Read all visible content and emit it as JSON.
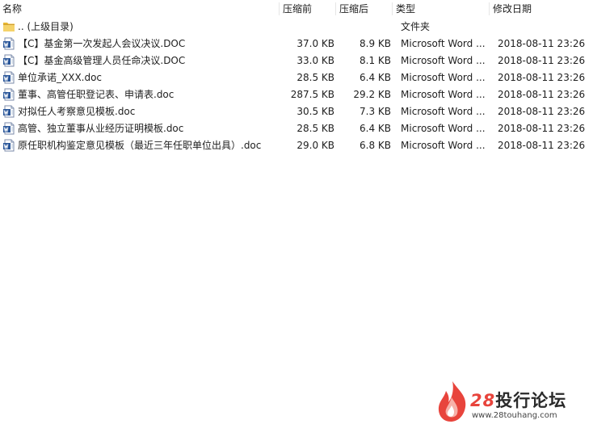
{
  "columns": {
    "name": "名称",
    "size": "压缩前",
    "compressed": "压缩后",
    "type": "类型",
    "modified": "修改日期"
  },
  "parent_row": {
    "name": ".. (上级目录)",
    "type": "文件夹",
    "icon": "folder-icon"
  },
  "files": [
    {
      "name": "【C】基金第一次发起人会议决议.DOC",
      "size": "37.0 KB",
      "compressed": "8.9 KB",
      "type": "Microsoft Word ...",
      "modified": "2018-08-11 23:26",
      "icon": "word-doc-icon"
    },
    {
      "name": "【C】基金高级管理人员任命决议.DOC",
      "size": "33.0 KB",
      "compressed": "8.1 KB",
      "type": "Microsoft Word ...",
      "modified": "2018-08-11 23:26",
      "icon": "word-doc-icon"
    },
    {
      "name": "单位承诺_XXX.doc",
      "size": "28.5 KB",
      "compressed": "6.4 KB",
      "type": "Microsoft Word ...",
      "modified": "2018-08-11 23:26",
      "icon": "word-doc-icon"
    },
    {
      "name": "董事、高管任职登记表、申请表.doc",
      "size": "287.5 KB",
      "compressed": "29.2 KB",
      "type": "Microsoft Word ...",
      "modified": "2018-08-11 23:26",
      "icon": "word-doc-icon"
    },
    {
      "name": "对拟任人考察意见模板.doc",
      "size": "30.5 KB",
      "compressed": "7.3 KB",
      "type": "Microsoft Word ...",
      "modified": "2018-08-11 23:26",
      "icon": "word-doc-icon"
    },
    {
      "name": "高管、独立董事从业经历证明模板.doc",
      "size": "28.5 KB",
      "compressed": "6.4 KB",
      "type": "Microsoft Word ...",
      "modified": "2018-08-11 23:26",
      "icon": "word-doc-icon"
    },
    {
      "name": "原任职机构鉴定意见模板（最近三年任职单位出具）.doc",
      "size": "29.0 KB",
      "compressed": "6.8 KB",
      "type": "Microsoft Word ...",
      "modified": "2018-08-11 23:26",
      "icon": "word-doc-icon"
    }
  ],
  "watermark": {
    "number": "28",
    "brand": "投行论坛",
    "url": "www.28touhang.com"
  },
  "colors": {
    "watermark_red": "#e8443c",
    "folder_yellow": "#f2c94c",
    "word_blue": "#2b579a"
  }
}
